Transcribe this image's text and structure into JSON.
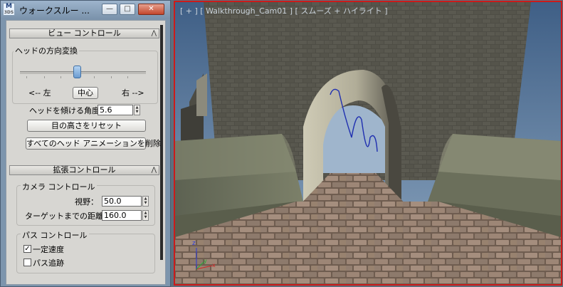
{
  "window": {
    "title": "ウォークスルー ...",
    "icon_text": "M",
    "icon_sub": "3DS",
    "minimize": "—",
    "maximize": "□",
    "close": "✕"
  },
  "view_control": {
    "header": "ビュー コントロール",
    "collapse_glyph": "⌃",
    "group_label": "ヘッドの方向変換",
    "slider_value": 0.45,
    "left_label": "<-- 左",
    "center_button": "中心",
    "right_label": "右 -->",
    "tilt_label": "ヘッドを傾ける角度",
    "tilt_value": "5.6",
    "reset_eye_button": "目の高さをリセット",
    "delete_anim_button": "すべてのヘッド アニメーションを削除"
  },
  "advanced_control": {
    "header": "拡張コントロール",
    "camera_group": "カメラ コントロール",
    "fov_label": "視野：",
    "fov_value": "50.0",
    "target_label": "ターゲットまでの距離：",
    "target_value": "160.0",
    "path_group": "パス コントロール",
    "constant_speed_label": "一定速度",
    "constant_speed_checked": true,
    "follow_path_label": "パス追跡",
    "follow_path_checked": false
  },
  "viewport": {
    "label": "[ + ] [ Walkthrough_Cam01 ] [ スムーズ + ハイライト ]",
    "border_color": "#cc1a1a",
    "path_color": "#1f2fb0",
    "axis_z": "z",
    "axis_y": "y",
    "axis_x": "x"
  }
}
